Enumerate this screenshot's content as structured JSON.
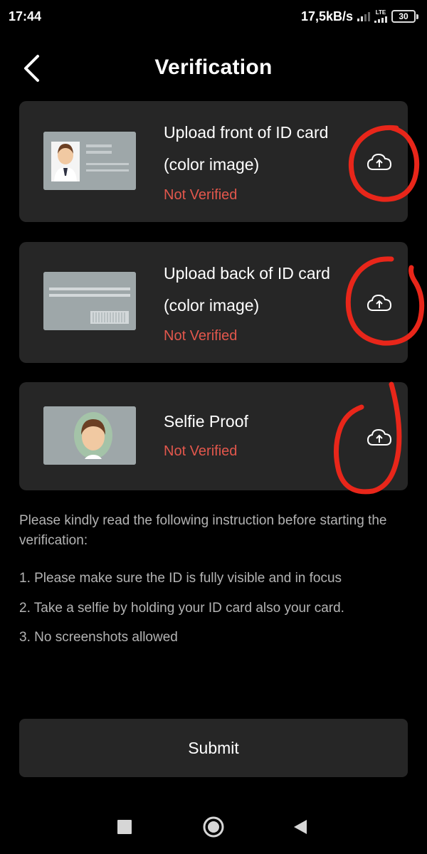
{
  "status_bar": {
    "time": "17:44",
    "network_speed": "17,5kB/s",
    "network_type": "LTE",
    "battery": "30",
    "icons": [
      "signal-icon",
      "lte-signal-icon",
      "battery-icon"
    ]
  },
  "header": {
    "title": "Verification",
    "back_icon": "chevron-left-icon"
  },
  "cards": [
    {
      "title_line1": "Upload front of ID card",
      "title_line2": "(color image)",
      "status": "Not Verified",
      "thumbnail": "id-front-icon",
      "action_icon": "cloud-upload-icon"
    },
    {
      "title_line1": "Upload back of ID card",
      "title_line2": "(color image)",
      "status": "Not Verified",
      "thumbnail": "id-back-icon",
      "action_icon": "cloud-upload-icon"
    },
    {
      "title_line1": "Selfie Proof",
      "status": "Not Verified",
      "thumbnail": "selfie-icon",
      "action_icon": "cloud-upload-icon"
    }
  ],
  "instructions": {
    "intro": "Please kindly read the following instruction before starting the verification:",
    "steps": [
      "1. Please make sure the ID is fully visible and in focus",
      "2. Take a selfie by holding your ID card also your card.",
      "3. No screenshots allowed"
    ]
  },
  "submit_label": "Submit",
  "nav_bar": {
    "icons": [
      "recents-square-icon",
      "home-circle-icon",
      "back-triangle-icon"
    ]
  },
  "colors": {
    "background": "#000000",
    "card": "#262626",
    "status_red": "#e2574c",
    "annotation_red": "#e8261a"
  }
}
